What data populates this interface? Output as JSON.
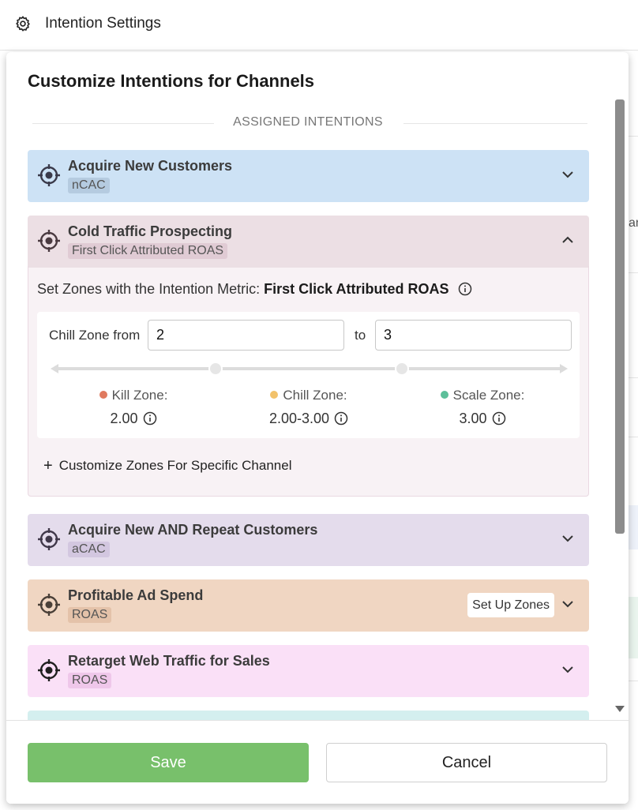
{
  "topbar": {
    "title": "Intention Settings",
    "icon": "gear-icon"
  },
  "modal": {
    "title": "Customize Intentions for Channels",
    "section_label": "ASSIGNED INTENTIONS"
  },
  "cards": [
    {
      "name": "Acquire New Customers",
      "metric": "nCAC",
      "bg": "#cde2f5",
      "tag_bg": "#b5cbe0",
      "expanded": false
    },
    {
      "name": "Cold Traffic Prospecting",
      "metric": "First Click Attributed ROAS",
      "bg": "#ecdfe4",
      "tag_bg": "#e0cbd4",
      "expanded": true
    },
    {
      "name": "Acquire New AND Repeat Customers",
      "metric": "aCAC",
      "bg": "#e4dcec",
      "tag_bg": "#d3c7e0",
      "expanded": false
    },
    {
      "name": "Profitable Ad Spend",
      "metric": "ROAS",
      "bg": "#f0d6c2",
      "tag_bg": "#e4c2a9",
      "expanded": false,
      "action": "Set Up Zones"
    },
    {
      "name": "Retarget Web Traffic for Sales",
      "metric": "ROAS",
      "bg": "#fae0f7",
      "tag_bg": "#efc7ea",
      "expanded": false
    }
  ],
  "expanded": {
    "metric_prefix": "Set Zones with the Intention Metric:",
    "metric_name": "First Click Attributed ROAS",
    "chill_from_label": "Chill Zone from",
    "to_label": "to",
    "from_value": "2",
    "to_value": "3",
    "zones": [
      {
        "name": "Kill Zone:",
        "value": "2.00",
        "color": "#e07a5f"
      },
      {
        "name": "Chill Zone:",
        "value": "2.00-3.00",
        "color": "#f2c26b"
      },
      {
        "name": "Scale Zone:",
        "value": "3.00",
        "color": "#5cbf9a"
      }
    ],
    "customize_label": "Customize Zones For Specific Channel"
  },
  "footer": {
    "save_label": "Save",
    "cancel_label": "Cancel"
  },
  "colors": {
    "save_green": "#78c06b",
    "expanded_bg": "#f8f2f5"
  }
}
